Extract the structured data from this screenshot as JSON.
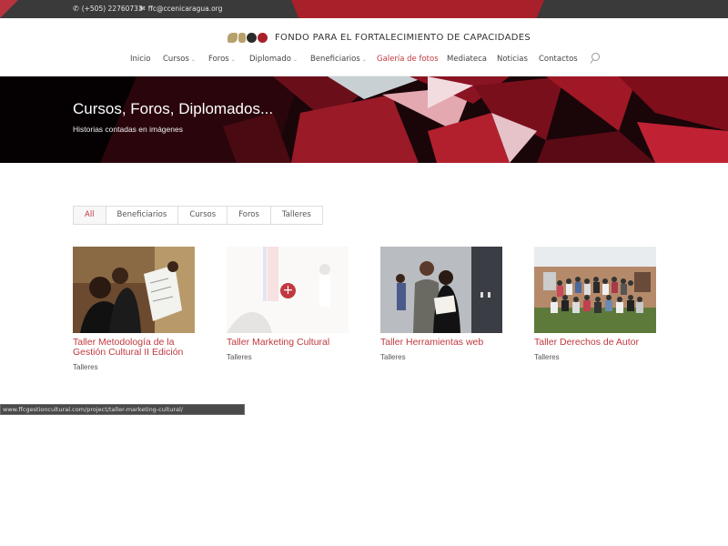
{
  "topbar": {
    "phone": "(+505) 22760733",
    "email": "ffc@ccenicaragua.org"
  },
  "header": {
    "logo_text": "FONDO PARA EL FORTALECIMIENTO DE CAPACIDADES"
  },
  "nav": [
    {
      "label": "Inicio",
      "dropdown": false
    },
    {
      "label": "Cursos",
      "dropdown": true
    },
    {
      "label": "Foros",
      "dropdown": true
    },
    {
      "label": "Diplomado",
      "dropdown": true
    },
    {
      "label": "Beneficiarios",
      "dropdown": true
    },
    {
      "label": "Galería de fotos",
      "dropdown": false,
      "active": true
    },
    {
      "label": "Mediateca",
      "dropdown": false
    },
    {
      "label": "Noticias",
      "dropdown": false
    },
    {
      "label": "Contactos",
      "dropdown": false
    }
  ],
  "hero": {
    "title": "Cursos, Foros, Diplomados...",
    "subtitle": "Historias contadas en imágenes"
  },
  "filters": [
    "All",
    "Beneficiarios",
    "Cursos",
    "Foros",
    "Talleres"
  ],
  "portfolio": [
    {
      "title": "Taller Metodología de la Gestión Cultural II Edición",
      "category": "Talleres"
    },
    {
      "title": "Taller Marketing Cultural",
      "category": "Talleres"
    },
    {
      "title": "Taller Herramientas web",
      "category": "Talleres"
    },
    {
      "title": "Taller Derechos de Autor",
      "category": "Talleres"
    }
  ],
  "status_url": "www.ffcgestioncultural.com/project/taller-marketing-cultural/",
  "colors": {
    "accent": "#c0393f",
    "topbar": "#3a3a3a",
    "hero_dark": "#1a0509"
  }
}
